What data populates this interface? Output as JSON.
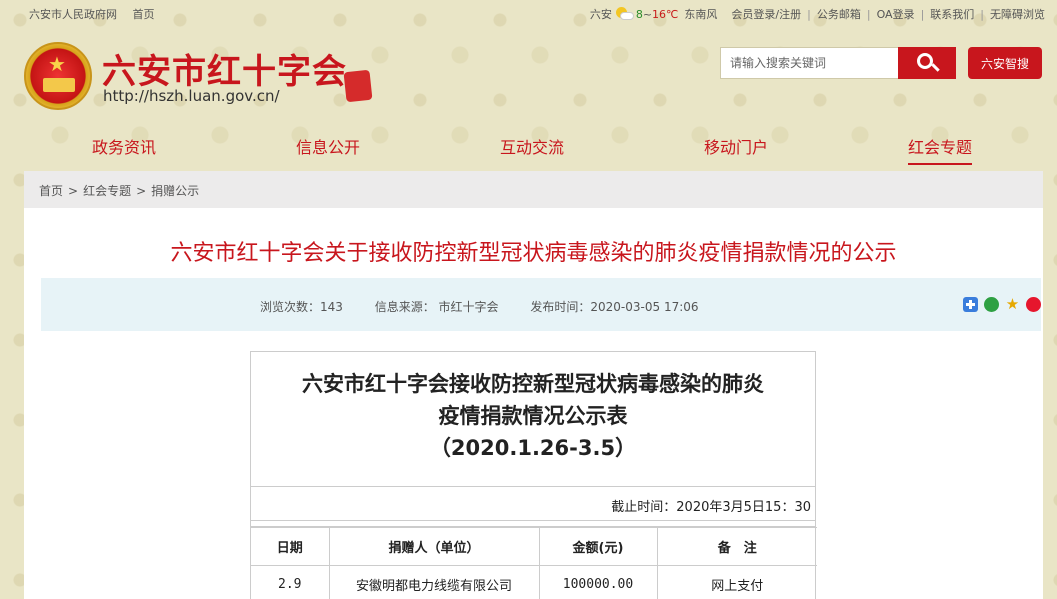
{
  "topbar": {
    "links_left": [
      "六安市人民政府网",
      "首页"
    ],
    "weather_city": "六安",
    "temp_low": "8",
    "temp_sep": "~",
    "temp_high": "16℃",
    "wind": "东南风",
    "links_right": [
      "会员登录/注册",
      "公务邮箱",
      "OA登录",
      "联系我们",
      "无障碍浏览"
    ]
  },
  "header": {
    "site_title": "六安市红十字会",
    "site_url": "http://hszh.luan.gov.cn/",
    "search_placeholder": "请输入搜索关键词",
    "smart_search_label": "六安智搜"
  },
  "nav": {
    "items": [
      "政务资讯",
      "信息公开",
      "互动交流",
      "移动门户",
      "红会专题"
    ],
    "active_index": 4
  },
  "breadcrumb": [
    "首页",
    "红会专题",
    "捐赠公示"
  ],
  "article": {
    "title": "六安市红十字会关于接收防控新型冠状病毒感染的肺炎疫情捐款情况的公示",
    "views": "浏览次数：143",
    "source": "信息来源： 市红十字会",
    "published": "发布时间：2020-03-05 17:06"
  },
  "doc": {
    "heading_line1": "六安市红十字会接收防控新型冠状病毒感染的肺炎",
    "heading_line2": "疫情捐款情况公示表",
    "heading_line3": "（2020.1.26-3.5）",
    "deadline": "截止时间：2020年3月5日15：30",
    "columns": [
      "日期",
      "捐赠人（单位）",
      "金额(元)",
      "备　注"
    ],
    "rows": [
      [
        "2.9",
        "安徽明都电力线缆有限公司",
        "100000.00",
        "网上支付"
      ]
    ]
  },
  "colors": {
    "brand_red": "#c8161d",
    "meta_bg": "#e7f3f7",
    "page_bg": "#e9e5c6"
  }
}
